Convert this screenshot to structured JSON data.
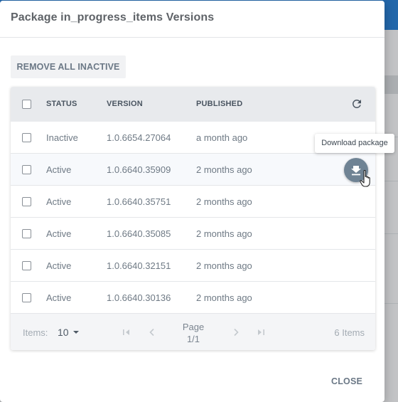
{
  "dialog": {
    "title": "Package in_progress_items Versions",
    "remove_inactive_label": "REMOVE ALL INACTIVE",
    "close_label": "CLOSE"
  },
  "table": {
    "headers": {
      "status": "STATUS",
      "version": "VERSION",
      "published": "PUBLISHED"
    },
    "rows": [
      {
        "status": "Inactive",
        "version": "1.0.6654.27064",
        "published": "a month ago"
      },
      {
        "status": "Active",
        "version": "1.0.6640.35909",
        "published": "2 months ago"
      },
      {
        "status": "Active",
        "version": "1.0.6640.35751",
        "published": "2 months ago"
      },
      {
        "status": "Active",
        "version": "1.0.6640.35085",
        "published": "2 months ago"
      },
      {
        "status": "Active",
        "version": "1.0.6640.32151",
        "published": "2 months ago"
      },
      {
        "status": "Active",
        "version": "1.0.6640.30136",
        "published": "2 months ago"
      }
    ],
    "refresh_icon": "refresh-icon",
    "download_icon": "download-icon"
  },
  "tooltip": {
    "text": "Download package"
  },
  "pagination": {
    "items_label": "Items:",
    "page_size": "10",
    "page_word": "Page",
    "page_of": "1/1",
    "item_count": "6 Items"
  },
  "colors": {
    "accent_button": "#6f8394",
    "header_bg": "#e8eaed",
    "text": "#6f7a85"
  }
}
